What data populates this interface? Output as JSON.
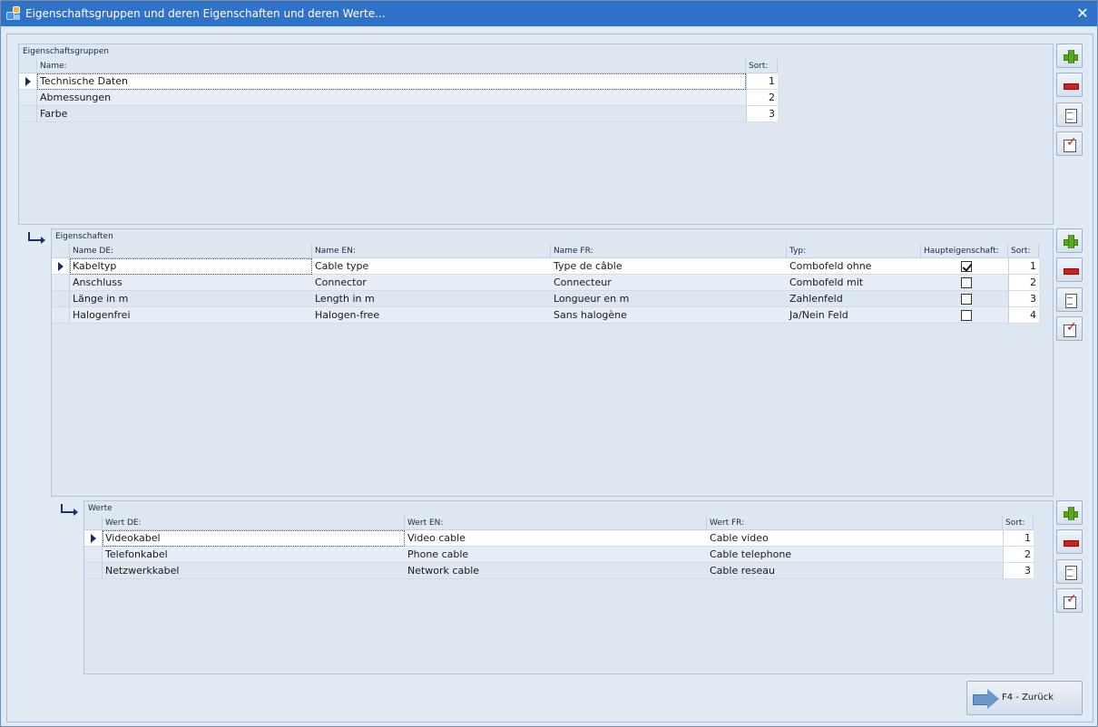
{
  "window": {
    "title": "Eigenschaftsgruppen und deren Eigenschaften und deren Werte...",
    "close": "✕"
  },
  "groups": {
    "caption": "Eigenschaftsgruppen",
    "columns": {
      "name": "Name:",
      "sort": "Sort:"
    },
    "rows": [
      {
        "name": "Technische Daten",
        "sort": "1"
      },
      {
        "name": "Abmessungen",
        "sort": "2"
      },
      {
        "name": "Farbe",
        "sort": "3"
      }
    ],
    "selected_row": 0
  },
  "properties": {
    "caption": "Eigenschaften",
    "columns": {
      "de": "Name DE:",
      "en": "Name EN:",
      "fr": "Name FR:",
      "typ": "Typ:",
      "main": "Haupteigenschaft:",
      "sort": "Sort:"
    },
    "rows": [
      {
        "de": "Kabeltyp",
        "en": "Cable type",
        "fr": "Type de câble",
        "typ": "Combofeld ohne",
        "main": true,
        "sort": "1"
      },
      {
        "de": "Anschluss",
        "en": "Connector",
        "fr": "Connecteur",
        "typ": "Combofeld mit",
        "main": false,
        "sort": "2"
      },
      {
        "de": "Länge in m",
        "en": "Length in m",
        "fr": "Longueur en m",
        "typ": "Zahlenfeld",
        "main": false,
        "sort": "3"
      },
      {
        "de": "Halogenfrei",
        "en": "Halogen-free",
        "fr": "Sans halogène",
        "typ": "Ja/Nein Feld",
        "main": false,
        "sort": "4"
      }
    ],
    "selected_row": 0
  },
  "values": {
    "caption": "Werte",
    "columns": {
      "de": "Wert DE:",
      "en": "Wert EN:",
      "fr": "Wert FR:",
      "sort": "Sort:"
    },
    "rows": [
      {
        "de": "Videokabel",
        "en": "Video cable",
        "fr": "Cable video",
        "sort": "1"
      },
      {
        "de": "Telefonkabel",
        "en": "Phone cable",
        "fr": "Cable telephone",
        "sort": "2"
      },
      {
        "de": "Netzwerkkabel",
        "en": "Network cable",
        "fr": "Cable reseau",
        "sort": "3"
      }
    ],
    "selected_row": 0
  },
  "icons": {
    "add": "plus-icon",
    "remove": "minus-icon",
    "copy": "copy-icon",
    "edit": "edit-icon",
    "link": "link-arrow-icon",
    "back": "right-arrow-icon"
  },
  "colors": {
    "titlebar": "#2f72c9",
    "background": "#dfe8f3",
    "add": "#5aa81e",
    "remove": "#c82323"
  },
  "footer": {
    "back_label": "F4 - Zurück"
  }
}
